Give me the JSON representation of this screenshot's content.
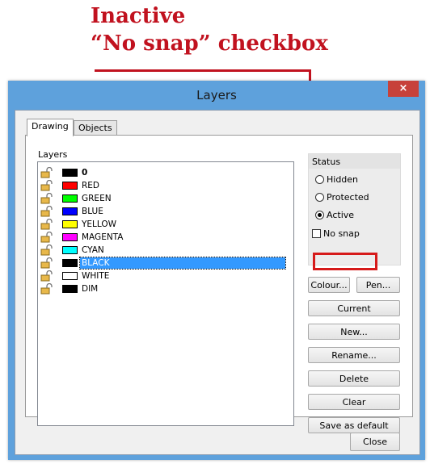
{
  "annotation": {
    "line1": "Inactive",
    "line2": "“No snap” checkbox",
    "color": "#c1121f"
  },
  "window": {
    "title": "Layers",
    "close_symbol": "×"
  },
  "tabs": [
    {
      "label": "Drawing",
      "active": true
    },
    {
      "label": "Objects",
      "active": false
    }
  ],
  "layers_group": {
    "label": "Layers"
  },
  "layers": [
    {
      "name": "0",
      "color": "#000000",
      "bold": true
    },
    {
      "name": "RED",
      "color": "#ff0000"
    },
    {
      "name": "GREEN",
      "color": "#00ff00"
    },
    {
      "name": "BLUE",
      "color": "#0000ff"
    },
    {
      "name": "YELLOW",
      "color": "#ffff00"
    },
    {
      "name": "MAGENTA",
      "color": "#ff00ff"
    },
    {
      "name": "CYAN",
      "color": "#00ffff"
    },
    {
      "name": "BLACK",
      "color": "#000000",
      "selected": true
    },
    {
      "name": "WHITE",
      "color": "#ffffff"
    },
    {
      "name": "DIM",
      "color": "#000000"
    }
  ],
  "status": {
    "label": "Status",
    "hidden_label": "Hidden",
    "protected_label": "Protected",
    "active_label": "Active",
    "active_checked": true,
    "no_snap_label": "No snap",
    "no_snap_checked": false
  },
  "buttons": {
    "colour": "Colour...",
    "pen": "Pen...",
    "current": "Current",
    "new": "New...",
    "rename": "Rename...",
    "delete": "Delete",
    "clear": "Clear",
    "save_default": "Save as default",
    "close": "Close"
  }
}
